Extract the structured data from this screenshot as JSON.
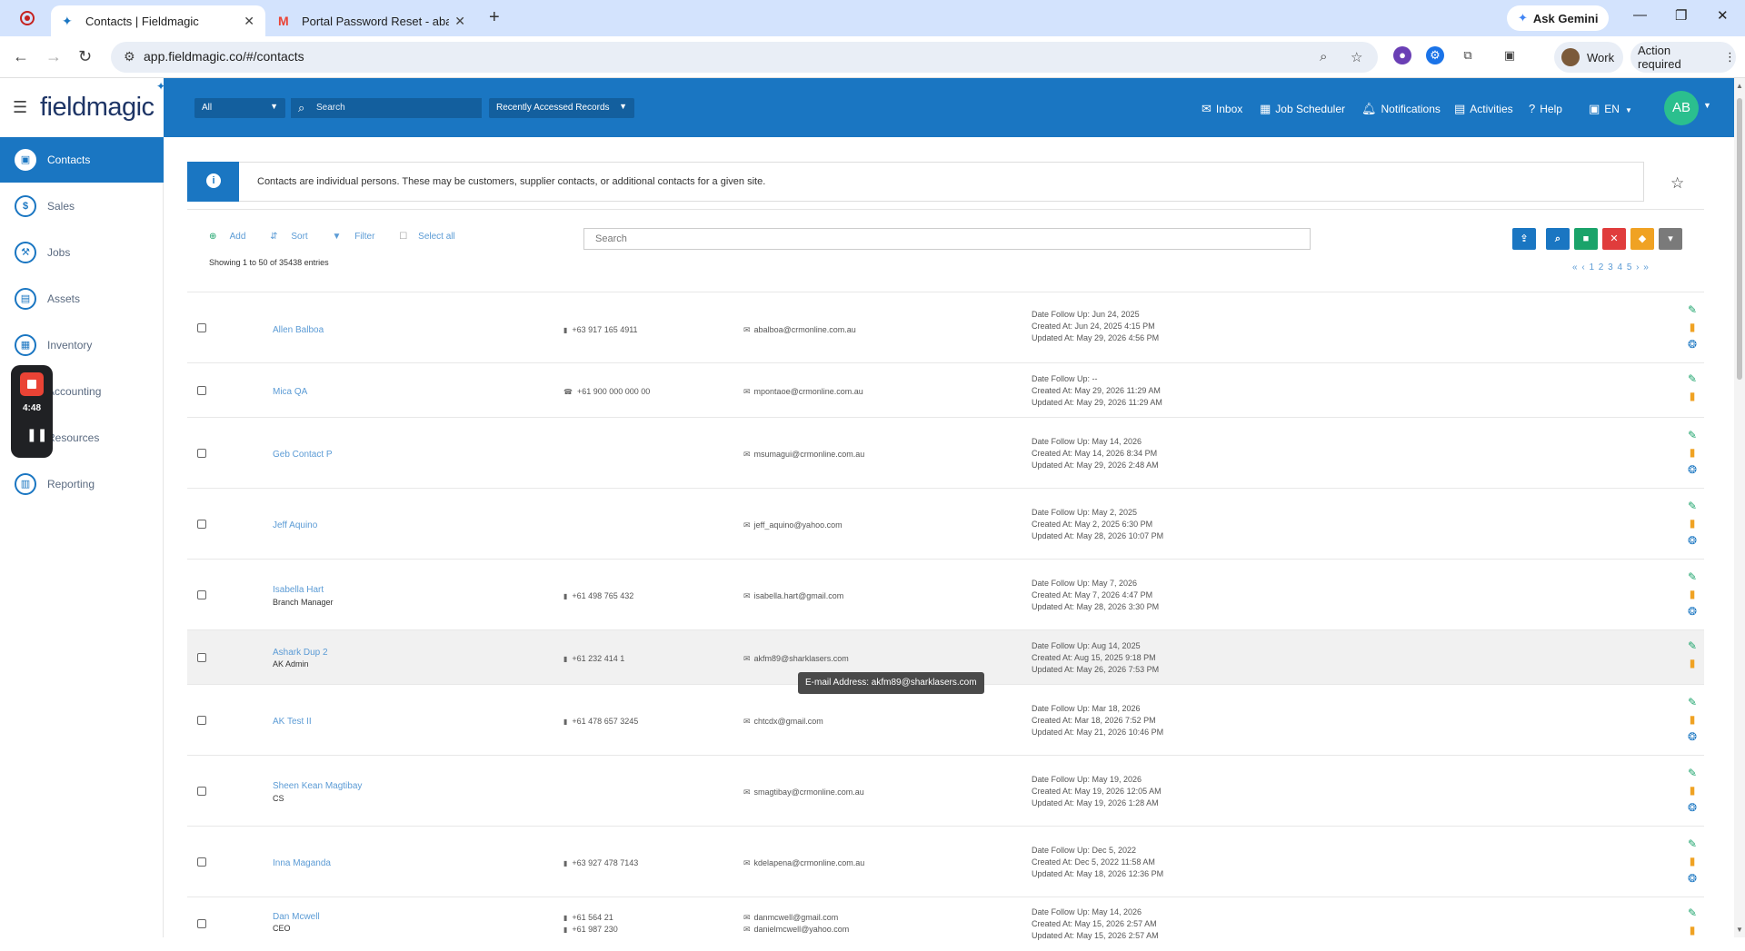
{
  "browser": {
    "tabs": [
      {
        "title": "Contacts | Fieldmagic",
        "active": true
      },
      {
        "title": "Portal Password Reset - abalbo",
        "active": false
      }
    ],
    "ask_gemini": "Ask Gemini",
    "url": "app.fieldmagic.co/#/contacts",
    "profile": "Work",
    "action_required": "Action required"
  },
  "app": {
    "logo": "fieldmagic",
    "header": {
      "scope_select": "All",
      "search_placeholder": "Search",
      "recent_select": "Recently Accessed Records",
      "nav": [
        "Inbox",
        "Job Scheduler",
        "Notifications",
        "Activities",
        "Help",
        "EN"
      ],
      "avatar_initials": "AB"
    },
    "sidebar": {
      "items": [
        {
          "label": "Contacts",
          "icon": "contacts-icon",
          "active": true
        },
        {
          "label": "Sales",
          "icon": "dollar-icon"
        },
        {
          "label": "Jobs",
          "icon": "wrench-icon"
        },
        {
          "label": "Assets",
          "icon": "briefcase-icon"
        },
        {
          "label": "Inventory",
          "icon": "inventory-icon"
        },
        {
          "label": "Accounting",
          "icon": "accounting-icon"
        },
        {
          "label": "Resources",
          "icon": "resources-icon"
        },
        {
          "label": "Reporting",
          "icon": "report-icon"
        }
      ]
    },
    "recorder": {
      "time": "4:48"
    },
    "info_text": "Contacts are individual persons. These may be customers, supplier contacts, or additional contacts for a given site.",
    "toolbar": {
      "add": "Add",
      "sort": "Sort",
      "filter": "Filter",
      "select_all": "Select all",
      "showing": "Showing 1 to 50 of 35438 entries",
      "search_placeholder": "Search"
    },
    "pager": {
      "pages": "1 2 3 4 5"
    },
    "action_colors": {
      "upload": "#1a76c2",
      "search": "#1a76c2",
      "save": "#1aa36a",
      "delete": "#e03c3c",
      "tag": "#f0a223",
      "more": "#7a7a7a"
    },
    "tooltip": "E-mail Address: akfm89@sharklasers.com",
    "contacts": [
      {
        "name": "Allen Balboa",
        "title": "",
        "phones": [
          "+63 917 165 4911"
        ],
        "emails": [
          "abalboa@crmonline.com.au"
        ],
        "follow_up": "Date Follow Up: Jun 24, 2025",
        "created": "Created At: Jun 24, 2025 4:15 PM",
        "updated": "Updated At: May 29, 2026 4:56 PM"
      },
      {
        "name": "Mica QA",
        "title": "",
        "phones": [
          "+61 900 000 000 00"
        ],
        "emails": [
          "mpontaoe@crmonline.com.au"
        ],
        "follow_up": "Date Follow Up: --",
        "created": "Created At: May 29, 2026 11:29 AM",
        "updated": "Updated At: May 29, 2026 11:29 AM"
      },
      {
        "name": "Geb Contact P",
        "title": "",
        "phones": [],
        "emails": [
          "msumagui@crmonline.com.au"
        ],
        "follow_up": "Date Follow Up: May 14, 2026",
        "created": "Created At: May 14, 2026 8:34 PM",
        "updated": "Updated At: May 29, 2026 2:48 AM"
      },
      {
        "name": "Jeff Aquino",
        "title": "",
        "phones": [],
        "emails": [
          "jeff_aquino@yahoo.com"
        ],
        "follow_up": "Date Follow Up: May 2, 2025",
        "created": "Created At: May 2, 2025 6:30 PM",
        "updated": "Updated At: May 28, 2026 10:07 PM"
      },
      {
        "name": "Isabella Hart",
        "title": "Branch Manager",
        "phones": [
          "+61 498 765 432"
        ],
        "emails": [
          "isabella.hart@gmail.com"
        ],
        "follow_up": "Date Follow Up: May 7, 2026",
        "created": "Created At: May 7, 2026 4:47 PM",
        "updated": "Updated At: May 28, 2026 3:30 PM"
      },
      {
        "name": "Ashark Dup 2",
        "title": "AK Admin",
        "phones": [
          "+61 232 414 1"
        ],
        "emails": [
          "akfm89@sharklasers.com"
        ],
        "follow_up": "Date Follow Up: Aug 14, 2025",
        "created": "Created At: Aug 15, 2025 9:18 PM",
        "updated": "Updated At: May 26, 2026 7:53 PM"
      },
      {
        "name": "AK Test II",
        "title": "",
        "phones": [
          "+61 478 657 3245"
        ],
        "emails": [
          "chtcdx@gmail.com"
        ],
        "follow_up": "Date Follow Up: Mar 18, 2026",
        "created": "Created At: Mar 18, 2026 7:52 PM",
        "updated": "Updated At: May 21, 2026 10:46 PM"
      },
      {
        "name": "Sheen Kean Magtibay",
        "title": "CS",
        "phones": [],
        "emails": [
          "smagtibay@crmonline.com.au"
        ],
        "follow_up": "Date Follow Up: May 19, 2026",
        "created": "Created At: May 19, 2026 12:05 AM",
        "updated": "Updated At: May 19, 2026 1:28 AM"
      },
      {
        "name": "Inna Maganda",
        "title": "",
        "phones": [
          "+63 927 478 7143"
        ],
        "emails": [
          "kdelapena@crmonline.com.au"
        ],
        "follow_up": "Date Follow Up: Dec 5, 2022",
        "created": "Created At: Dec 5, 2022 11:58 AM",
        "updated": "Updated At: May 18, 2026 12:36 PM"
      },
      {
        "name": "Dan Mcwell",
        "title": "CEO",
        "phones": [
          "+61 564 21",
          "+61 987 230"
        ],
        "emails": [
          "danmcwell@gmail.com",
          "danielmcwell@yahoo.com"
        ],
        "follow_up": "Date Follow Up: May 14, 2026",
        "created": "Created At: May 15, 2026 2:57 AM",
        "updated": "Updated At: May 15, 2026 2:57 AM"
      }
    ]
  }
}
